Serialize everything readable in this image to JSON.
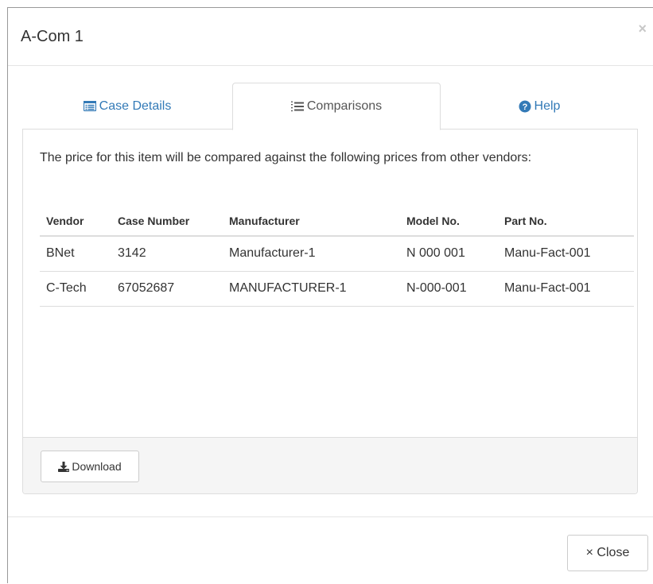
{
  "modal": {
    "title": "A-Com 1",
    "close_x": "×"
  },
  "tabs": [
    {
      "label": "Case Details",
      "icon": "list-alt-icon",
      "active": false
    },
    {
      "label": "Comparisons",
      "icon": "list-ol-icon",
      "active": true
    },
    {
      "label": "Help",
      "icon": "question-circle-icon",
      "active": false
    }
  ],
  "comparisons": {
    "intro": "The price for this item will be compared against the following prices from other vendors:",
    "headers": [
      "Vendor",
      "Case Number",
      "Manufacturer",
      "Model No.",
      "Part No."
    ],
    "rows": [
      [
        "BNet",
        "3142",
        "Manufacturer-1",
        "N 000 001",
        "Manu-Fact-001"
      ],
      [
        "C-Tech",
        "67052687",
        "MANUFACTURER-1",
        "N-000-001",
        "Manu-Fact-001"
      ]
    ],
    "download_label": "Download"
  },
  "footer": {
    "close_label": "× Close"
  },
  "colors": {
    "link": "#337ab7",
    "text": "#333333",
    "border": "#dddddd",
    "footer_bg": "#f5f5f5"
  }
}
